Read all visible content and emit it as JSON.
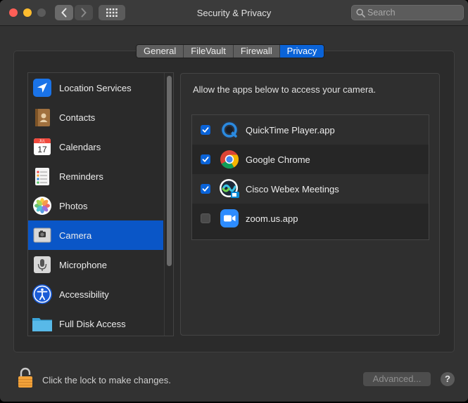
{
  "window": {
    "title": "Security & Privacy"
  },
  "search": {
    "placeholder": "Search"
  },
  "tabs": [
    {
      "label": "General"
    },
    {
      "label": "FileVault"
    },
    {
      "label": "Firewall"
    },
    {
      "label": "Privacy",
      "active": true
    }
  ],
  "sidebar": {
    "items": [
      {
        "label": "Location Services",
        "icon": "location-arrow-icon"
      },
      {
        "label": "Contacts",
        "icon": "contacts-book-icon"
      },
      {
        "label": "Calendars",
        "icon": "calendar-icon"
      },
      {
        "label": "Reminders",
        "icon": "reminders-list-icon"
      },
      {
        "label": "Photos",
        "icon": "photos-flower-icon"
      },
      {
        "label": "Camera",
        "icon": "camera-icon",
        "selected": true
      },
      {
        "label": "Microphone",
        "icon": "microphone-icon"
      },
      {
        "label": "Accessibility",
        "icon": "accessibility-icon"
      },
      {
        "label": "Full Disk Access",
        "icon": "folder-icon"
      }
    ],
    "calendar_month": "JUL",
    "calendar_day": "17"
  },
  "content": {
    "prompt": "Allow the apps below to access your camera.",
    "apps": [
      {
        "label": "QuickTime Player.app",
        "checked": true,
        "icon": "quicktime-icon"
      },
      {
        "label": "Google Chrome",
        "checked": true,
        "icon": "chrome-icon"
      },
      {
        "label": "Cisco Webex Meetings",
        "checked": true,
        "icon": "webex-icon"
      },
      {
        "label": "zoom.us.app",
        "checked": false,
        "icon": "zoom-icon"
      }
    ]
  },
  "footer": {
    "lock_text": "Click the lock to make changes.",
    "advanced_label": "Advanced...",
    "help_label": "?"
  },
  "colors": {
    "accent": "#0a63d8",
    "selection": "#0a56c7",
    "background": "#323232"
  }
}
